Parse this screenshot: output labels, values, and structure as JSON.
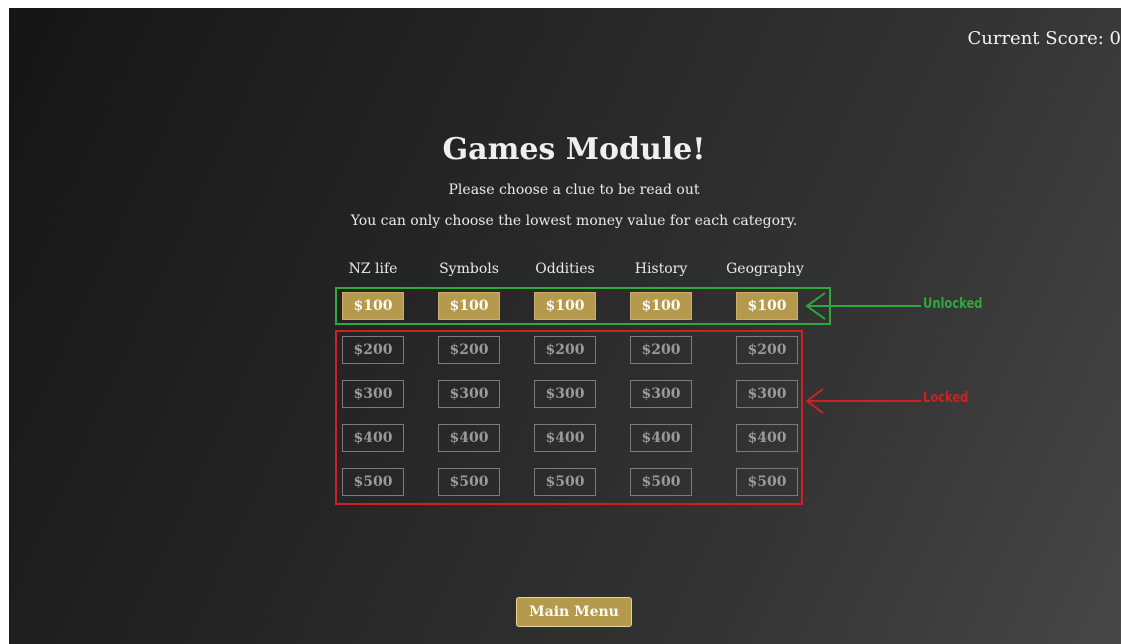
{
  "header": {
    "score_label": "Current Score: 0"
  },
  "main": {
    "title": "Games Module!",
    "instruction_1": "Please choose a clue to be read out",
    "instruction_2": "You can only choose the lowest money value for each category.",
    "categories": [
      "NZ life",
      "Symbols",
      "Oddities",
      "History",
      "Geography"
    ],
    "rows": [
      {
        "value": "$100",
        "state": "unlocked"
      },
      {
        "value": "$200",
        "state": "locked"
      },
      {
        "value": "$300",
        "state": "locked"
      },
      {
        "value": "$400",
        "state": "locked"
      },
      {
        "value": "$500",
        "state": "locked"
      }
    ]
  },
  "annotations": {
    "unlocked_label": "Unlocked",
    "locked_label": "Locked",
    "unlocked_color": "#2fa83c",
    "locked_color": "#cf2027"
  },
  "footer": {
    "main_menu_label": "Main Menu"
  },
  "colors": {
    "button_gold": "#b59a4e",
    "locked_border": "#7b7b7b",
    "background_dark": "#151515",
    "background_light": "#474747"
  }
}
